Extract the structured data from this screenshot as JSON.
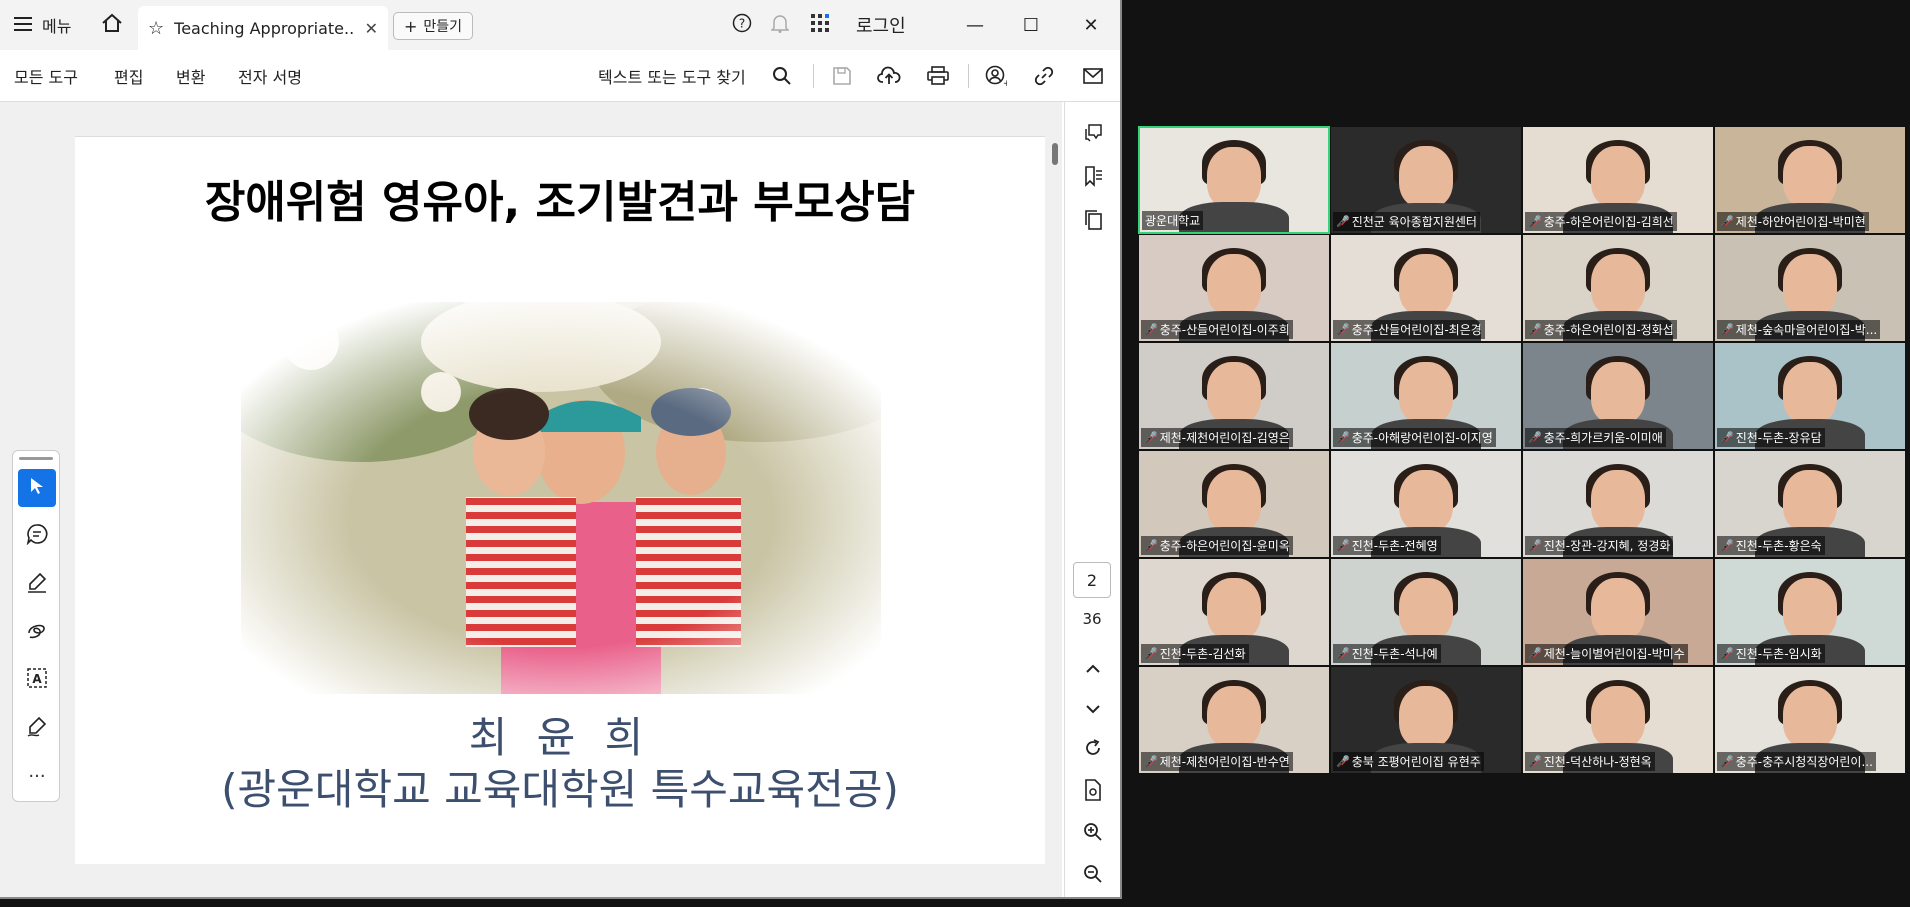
{
  "titlebar": {
    "menu_label": "메뉴",
    "tab_title": "Teaching Appropriate...",
    "new_button_label": "만들기",
    "login_label": "로그인"
  },
  "toolbar": {
    "menu_items": [
      "모든 도구",
      "편집",
      "변환",
      "전자 서명"
    ],
    "search_placeholder": "텍스트 또는 도구 찾기"
  },
  "slide": {
    "title": "장애위험 영유아, 조기발견과 부모상담",
    "author": "최 윤 희",
    "affiliation": "(광운대학교 교육대학원 특수교육전공)"
  },
  "pagination": {
    "current_page": "2",
    "total_pages": "36"
  },
  "colors": {
    "active_tool": "#1473e6",
    "active_speaker_border": "#35d37a",
    "mic_off": "#ff3b3b",
    "slide_text": "#3d4f6e"
  },
  "participants": [
    {
      "name": "광운대학교",
      "muted": false,
      "active": true,
      "bg": "#e9e6e0"
    },
    {
      "name": "진천군 육아종합지원센터",
      "muted": true,
      "active": false,
      "bg": "#2b2b2b"
    },
    {
      "name": "충주-하은어린이집-김희선",
      "muted": true,
      "active": false,
      "bg": "#e6ddd2"
    },
    {
      "name": "제천-하얀어린이집-박미현",
      "muted": true,
      "active": false,
      "bg": "#c8b59a"
    },
    {
      "name": "충주-산들어린이집-이주희",
      "muted": true,
      "active": false,
      "bg": "#d8cbc4"
    },
    {
      "name": "충주-산들어린이집-최은경",
      "muted": true,
      "active": false,
      "bg": "#e5ded6"
    },
    {
      "name": "충주-하은어린이집-정화섭",
      "muted": true,
      "active": false,
      "bg": "#d9d3c8"
    },
    {
      "name": "제천-숲속마을어린이집-박...",
      "muted": true,
      "active": false,
      "bg": "#c9c2b4"
    },
    {
      "name": "제천-제천어린이집-김영은",
      "muted": true,
      "active": false,
      "bg": "#d0cdc8"
    },
    {
      "name": "충주-아해랑어린이집-이지영",
      "muted": true,
      "active": false,
      "bg": "#c6d0cf"
    },
    {
      "name": "충주-희가르키움-이미애",
      "muted": true,
      "active": false,
      "bg": "#7c858c"
    },
    {
      "name": "진천-두촌-장유담",
      "muted": true,
      "active": false,
      "bg": "#a9c3c8"
    },
    {
      "name": "충주-하은어린이집-윤미옥",
      "muted": true,
      "active": false,
      "bg": "#d3c8bc"
    },
    {
      "name": "진천-두촌-전혜영",
      "muted": true,
      "active": false,
      "bg": "#e2e0dc"
    },
    {
      "name": "진천-장관-강지혜, 정경화",
      "muted": true,
      "active": false,
      "bg": "#dcdad6"
    },
    {
      "name": "진천-두촌-황은숙",
      "muted": true,
      "active": false,
      "bg": "#d8d5cf"
    },
    {
      "name": "진천-두촌-김선화",
      "muted": true,
      "active": false,
      "bg": "#ddd7cf"
    },
    {
      "name": "진천-두촌-석나예",
      "muted": true,
      "active": false,
      "bg": "#cfd3d0"
    },
    {
      "name": "제천-늘이별어린이집-박미수",
      "muted": true,
      "active": false,
      "bg": "#c8a995"
    },
    {
      "name": "진천-두촌-임시화",
      "muted": true,
      "active": false,
      "bg": "#cfd9d6"
    },
    {
      "name": "제천-제천어린이집-반수연",
      "muted": true,
      "active": false,
      "bg": "#d8cfc5"
    },
    {
      "name": "충북 조평어린이집 유현주",
      "muted": true,
      "active": false,
      "bg": "#2a2a2a"
    },
    {
      "name": "진천-덕산하나-정현옥",
      "muted": true,
      "active": false,
      "bg": "#e5ddd2"
    },
    {
      "name": "충주-충주시청직장어린이...",
      "muted": true,
      "active": false,
      "bg": "#e6e2dc"
    }
  ]
}
